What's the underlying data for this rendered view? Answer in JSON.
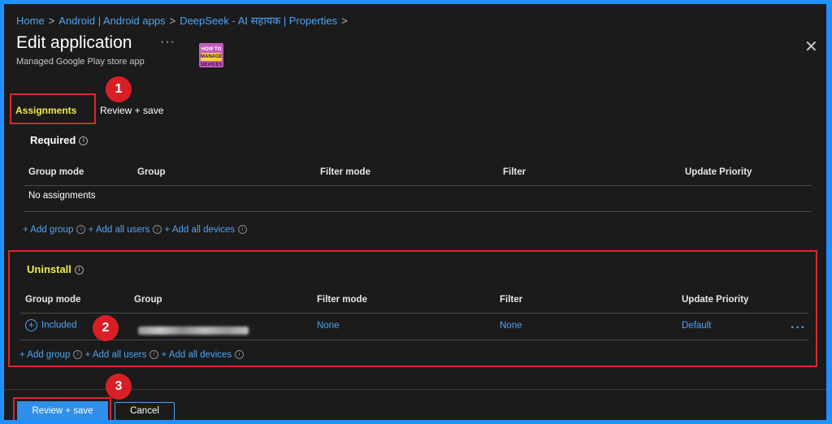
{
  "breadcrumb": {
    "items": [
      "Home",
      "Android | Android apps",
      "DeepSeek - AI सहायक | Properties"
    ],
    "separator": ">"
  },
  "header": {
    "title": "Edit application",
    "more": "···",
    "subtitle": "Managed Google Play store app",
    "logo_top": "HOW TO",
    "logo_bottom": "MANAGE DEVICES",
    "close": "✕"
  },
  "tabs": [
    {
      "label": "Assignments",
      "active": true
    },
    {
      "label": "Review + save",
      "active": false
    }
  ],
  "columns": [
    "Group mode",
    "Group",
    "Filter mode",
    "Filter",
    "Update Priority"
  ],
  "required": {
    "title": "Required",
    "empty_text": "No assignments",
    "add_group": "+ Add group",
    "add_all_users": "+ Add all users",
    "add_all_devices": "+ Add all devices"
  },
  "uninstall": {
    "title": "Uninstall",
    "row": {
      "group_mode": "Included",
      "filter_mode": "None",
      "filter": "None",
      "update_priority": "Default",
      "more": "···"
    },
    "add_group": "+ Add group",
    "add_all_users": "+ Add all users",
    "add_all_devices": "+ Add all devices"
  },
  "badges": [
    "1",
    "2",
    "3"
  ],
  "footer": {
    "primary": "Review + save",
    "secondary": "Cancel"
  },
  "colors": {
    "accent": "#4ea3f5",
    "highlight": "#f2e94e",
    "annotation": "#e0242c"
  }
}
